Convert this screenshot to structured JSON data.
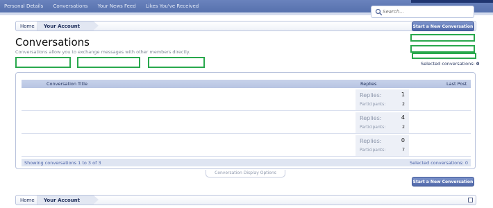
{
  "nav": {
    "links": [
      "Personal Details",
      "Conversations",
      "Your News Feed",
      "Likes You've Received"
    ]
  },
  "search": {
    "placeholder": "Search..."
  },
  "breadcrumb": {
    "home": "Home",
    "current": "Your Account"
  },
  "header": {
    "start_button": "Start a New Conversation",
    "title": "Conversations",
    "description": "Conversations allow you to exchange messages with other members directly.",
    "selected_label": "Selected conversations:",
    "selected_count": "0"
  },
  "list": {
    "columns": {
      "title": "Conversation Title",
      "replies": "Replies",
      "last_post": "Last Post"
    },
    "rows": [
      {
        "replies_label": "Replies:",
        "replies": "1",
        "participants_label": "Participants:",
        "participants": "2"
      },
      {
        "replies_label": "Replies:",
        "replies": "4",
        "participants_label": "Participants:",
        "participants": "2"
      },
      {
        "replies_label": "Replies:",
        "replies": "0",
        "participants_label": "Participants:",
        "participants": "7"
      }
    ],
    "footer_showing": "Showing conversations 1 to 3 of 3",
    "footer_selected": "Selected conversations: 0"
  },
  "display_options": "Conversation Display Options",
  "colors": {
    "nav": "#5670ad",
    "accent_green": "#29a84d",
    "link": "#1e2e5a"
  }
}
